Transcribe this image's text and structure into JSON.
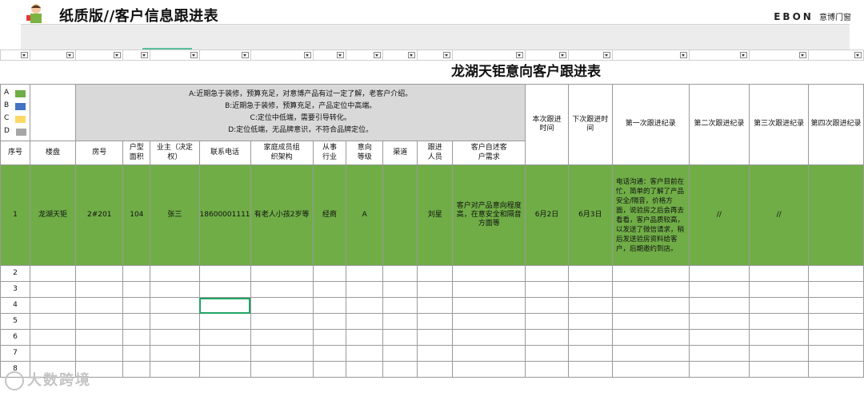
{
  "banner": {
    "title": "纸质版//客户信息跟进表",
    "brand": "EBON",
    "brand_cn": "意博门窗"
  },
  "sheet": {
    "title": "龙湖天钜意向客户跟进表",
    "legend": [
      {
        "letter": "A",
        "color": "#70ad47"
      },
      {
        "letter": "B",
        "color": "#4472c4"
      },
      {
        "letter": "C",
        "color": "#ffd966"
      },
      {
        "letter": "D",
        "color": "#a6a6a6"
      }
    ],
    "descriptions": [
      "A:近期急于装修，预算充足，对意博产品有过一定了解，老客户介绍。",
      "B:近期急于装修，预算充足，产品定位中高端。",
      "C:定位中低端，需要引导转化。",
      "D:定位低端，无品牌意识，不符合品牌定位。"
    ],
    "follow_headers": {
      "this_time": "本次跟进时间",
      "next_time": "下次跟进时间",
      "first": "第一次跟进纪录",
      "second": "第二次跟进纪录",
      "third": "第三次跟进纪录",
      "fourth": "第四次跟进纪录"
    },
    "columns": [
      "序号",
      "楼盘",
      "房号",
      "户型面积",
      "业主（决定权）",
      "联系电话",
      "家庭成员组织架构",
      "从事行业",
      "意向等级",
      "渠道",
      "跟进人员",
      "客户自述客户需求"
    ],
    "record": {
      "no": "1",
      "property": "龙湖天钜",
      "room": "2#201",
      "area": "104",
      "owner": "张三",
      "phone": "18600001111",
      "family": "有老人小孩2岁等",
      "industry": "经商",
      "level": "A",
      "channel": "",
      "staff": "刘星",
      "needs": "客户对产品意向程度高，在意安全和隔音方面等",
      "this_time": "6月2日",
      "next_time": "6月3日",
      "first_note": "电话沟通：客户目前在忙，简单的了解了产品安全/隔音，价格方面，说验房之后会再去看看，客户品质较高，以发送了微信请求，稍后发送验房资料给客户，后期邀约到店。",
      "second_note": "//",
      "third_note": "//",
      "fourth_note": ""
    },
    "row_numbers": [
      "2",
      "3",
      "4",
      "5",
      "6",
      "7",
      "8"
    ]
  },
  "watermark": "大数跨境"
}
